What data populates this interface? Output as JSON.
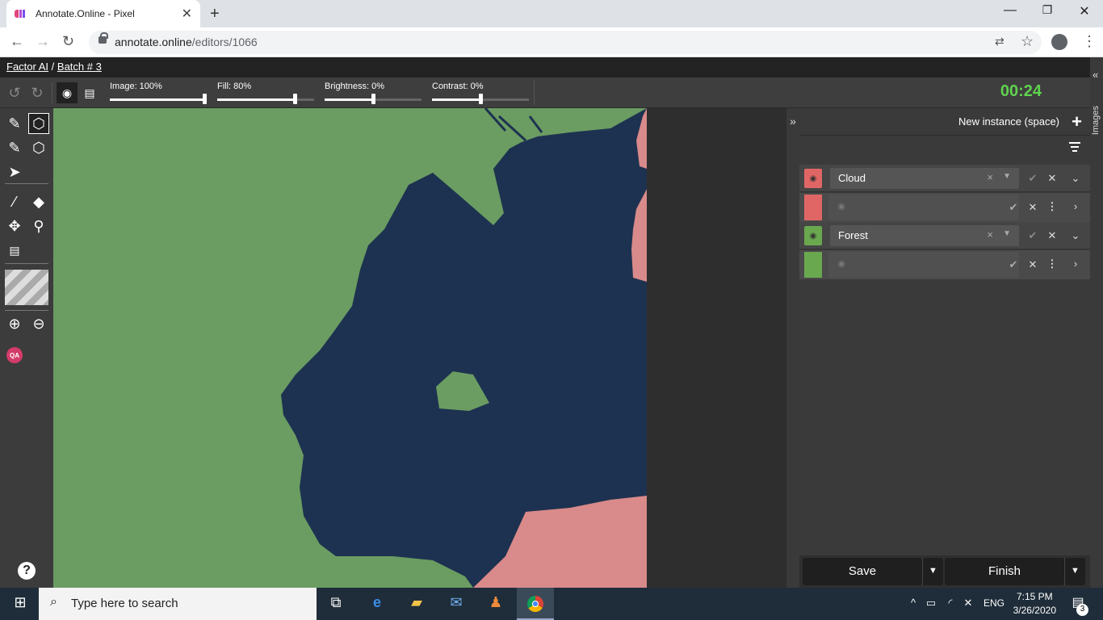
{
  "browser": {
    "tab_title": "Annotate.Online - Pixel",
    "url_host": "annotate.online",
    "url_path": "/editors/1066"
  },
  "breadcrumb": {
    "org": "Factor AI",
    "sep": "/",
    "batch": "Batch # 3"
  },
  "toolbar": {
    "sliders": [
      {
        "label": "Image: 100%",
        "value": 1.0
      },
      {
        "label": "Fill: 80%",
        "value": 0.8
      },
      {
        "label": "Brightness: 0%",
        "value": 0.5
      },
      {
        "label": "Contrast: 0%",
        "value": 0.5
      }
    ],
    "timer": "00:24"
  },
  "left_tools": {
    "qa_label": "QA",
    "help": "?"
  },
  "panel": {
    "new_instance": "New instance (space)",
    "classes": [
      {
        "name": "Cloud",
        "color": "#e06666"
      },
      {
        "name": "Forest",
        "color": "#6aa84f"
      }
    ],
    "clear_glyph": "×",
    "save": "Save",
    "finish": "Finish",
    "images_tab": "Images"
  },
  "colors": {
    "timer": "#5fd24e",
    "forest": "#6b9c62",
    "dark_region": "#1d3250",
    "cloud_region": "#d98a8a"
  },
  "taskbar": {
    "search_placeholder": "Type here to search",
    "lang": "ENG",
    "time": "7:15 PM",
    "date": "3/26/2020",
    "notif_count": "3"
  }
}
